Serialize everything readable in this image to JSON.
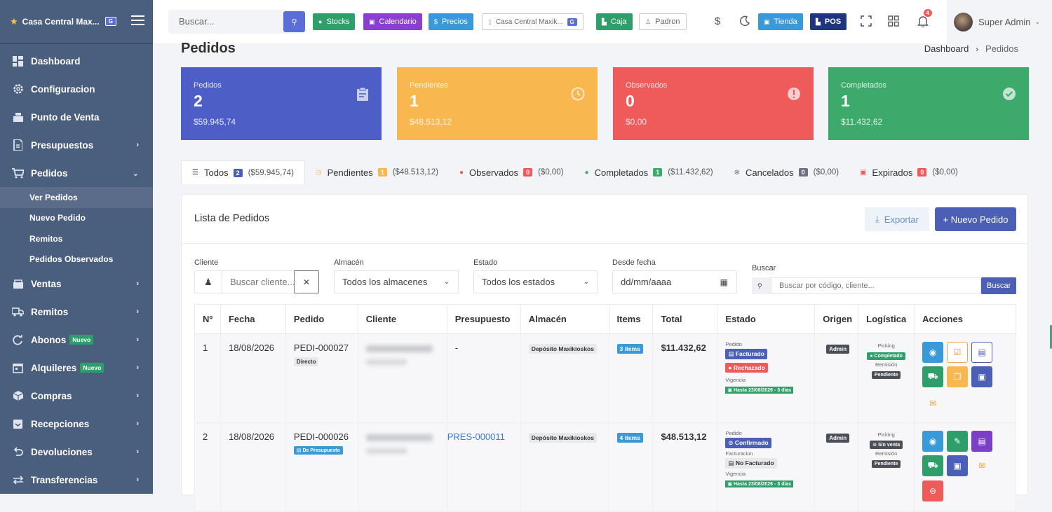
{
  "sidebar": {
    "brand": "Casa Central Max...",
    "brand_badge": "G",
    "items": [
      {
        "label": "Dashboard",
        "icon": "dashboard-icon"
      },
      {
        "label": "Configuracion",
        "icon": "gear-icon"
      },
      {
        "label": "Punto de Venta",
        "icon": "store-icon"
      },
      {
        "label": "Presupuestos",
        "icon": "document-icon"
      },
      {
        "label": "Pedidos",
        "icon": "cart-icon"
      },
      {
        "label": "Ventas",
        "icon": "sales-icon"
      },
      {
        "label": "Remitos",
        "icon": "truck-icon"
      },
      {
        "label": "Abonos",
        "icon": "refresh-icon",
        "badge": "Nuevo"
      },
      {
        "label": "Alquileres",
        "icon": "calendar-icon",
        "badge": "Nuevo"
      },
      {
        "label": "Compras",
        "icon": "box-icon"
      },
      {
        "label": "Recepciones",
        "icon": "inbox-icon"
      },
      {
        "label": "Devoluciones",
        "icon": "undo-icon"
      },
      {
        "label": "Transferencias",
        "icon": "transfer-icon"
      }
    ],
    "sub_items": [
      "Ver Pedidos",
      "Nuevo Pedido",
      "Remitos",
      "Pedidos Observados"
    ]
  },
  "topbar": {
    "search_placeholder": "Buscar...",
    "buttons": [
      {
        "label": "Stocks",
        "color": "#2e9f6a"
      },
      {
        "label": "Calendario",
        "color": "#8a3fd1"
      },
      {
        "label": "Precios",
        "color": "#3a9ad9"
      },
      {
        "label": "Casa Central Maxik...",
        "badge": "G"
      },
      {
        "label": "Caja",
        "color": "#2e9f6a"
      },
      {
        "label": "Padron"
      }
    ],
    "tienda": "Tienda",
    "pos": "POS",
    "notif_count": "4",
    "user_name": "Super Admin"
  },
  "header": {
    "title": "Pedidos",
    "breadcrumb": [
      "Dashboard",
      "Pedidos"
    ]
  },
  "cards": [
    {
      "label": "Pedidos",
      "value": "2",
      "amount": "$59.945,74",
      "color": "#4d5fc6"
    },
    {
      "label": "Pendientes",
      "value": "1",
      "amount": "$48.513,12",
      "color": "#f8b84f"
    },
    {
      "label": "Observados",
      "value": "0",
      "amount": "$0,00",
      "color": "#ef5a5a"
    },
    {
      "label": "Completados",
      "value": "1",
      "amount": "$11.432,62",
      "color": "#3caa6a"
    }
  ],
  "tabs": [
    {
      "label": "Todos",
      "count": "2",
      "amount": "($59.945,74)",
      "color": "#4c5fb6"
    },
    {
      "label": "Pendientes",
      "count": "1",
      "amount": "($48.513,12)",
      "color": "#f8b84f"
    },
    {
      "label": "Observados",
      "count": "0",
      "amount": "($0,00)",
      "color": "#ef5a5a"
    },
    {
      "label": "Completados",
      "count": "1",
      "amount": "($11.432,62)",
      "color": "#3caa6a"
    },
    {
      "label": "Cancelados",
      "count": "0",
      "amount": "($0,00)",
      "color": "#6b7280"
    },
    {
      "label": "Expirados",
      "count": "0",
      "amount": "($0,00)",
      "color": "#ef5a5a"
    }
  ],
  "panel": {
    "title": "Lista de Pedidos",
    "export_label": "Exportar",
    "new_label": "+ Nuevo Pedido"
  },
  "filters": {
    "cliente_label": "Cliente",
    "cliente_placeholder": "Buscar cliente...",
    "almacen_label": "Almacén",
    "almacen_value": "Todos los almacenes",
    "estado_label": "Estado",
    "estado_value": "Todos los estados",
    "desde_label": "Desde fecha",
    "desde_value": "dd/mm/aaaa",
    "buscar_label": "Buscar",
    "buscar_placeholder": "Buscar por código, cliente...",
    "buscar_button": "Buscar"
  },
  "table": {
    "headers": [
      "Nº",
      "Fecha",
      "Pedido",
      "Cliente",
      "Presupuesto",
      "Almacén",
      "Items",
      "Total",
      "Estado",
      "Origen",
      "Logística",
      "Acciones"
    ],
    "rows": [
      {
        "n": "1",
        "fecha": "18/08/2026",
        "pedido": "PEDI-000027",
        "tipo": "Directo",
        "presupuesto": "-",
        "almacen": "Depósito Maxikioskos",
        "items": "3 items",
        "total": "$11.432,62",
        "estado_l1": "Pedido",
        "estado_b1": "Facturado",
        "estado_b2": "Rechazado",
        "estado_l3": "Vigencia",
        "vigencia": "Hasta 23/08/2026 - 3 días",
        "origen": "Admin",
        "picking_l": "Picking",
        "picking": "Completado",
        "remision_l": "Remisión",
        "remision": "Pendiente"
      },
      {
        "n": "2",
        "fecha": "18/08/2026",
        "pedido": "PEDI-000026",
        "tipo": "De Presupuesto",
        "presupuesto": "PRES-000011",
        "almacen": "Depósito Maxikioskos",
        "items": "4 items",
        "total": "$48.513,12",
        "estado_l1": "Pedido",
        "estado_b1": "Confirmado",
        "estado_l2": "Facturacion",
        "estado_b2": "No Facturado",
        "estado_l3": "Vigencia",
        "vigencia": "Hasta 23/08/2026 - 3 días",
        "origen": "Admin",
        "picking_l": "Picking",
        "picking": "Sin venta",
        "remision_l": "Remisión",
        "remision": "Pendiente"
      }
    ]
  }
}
